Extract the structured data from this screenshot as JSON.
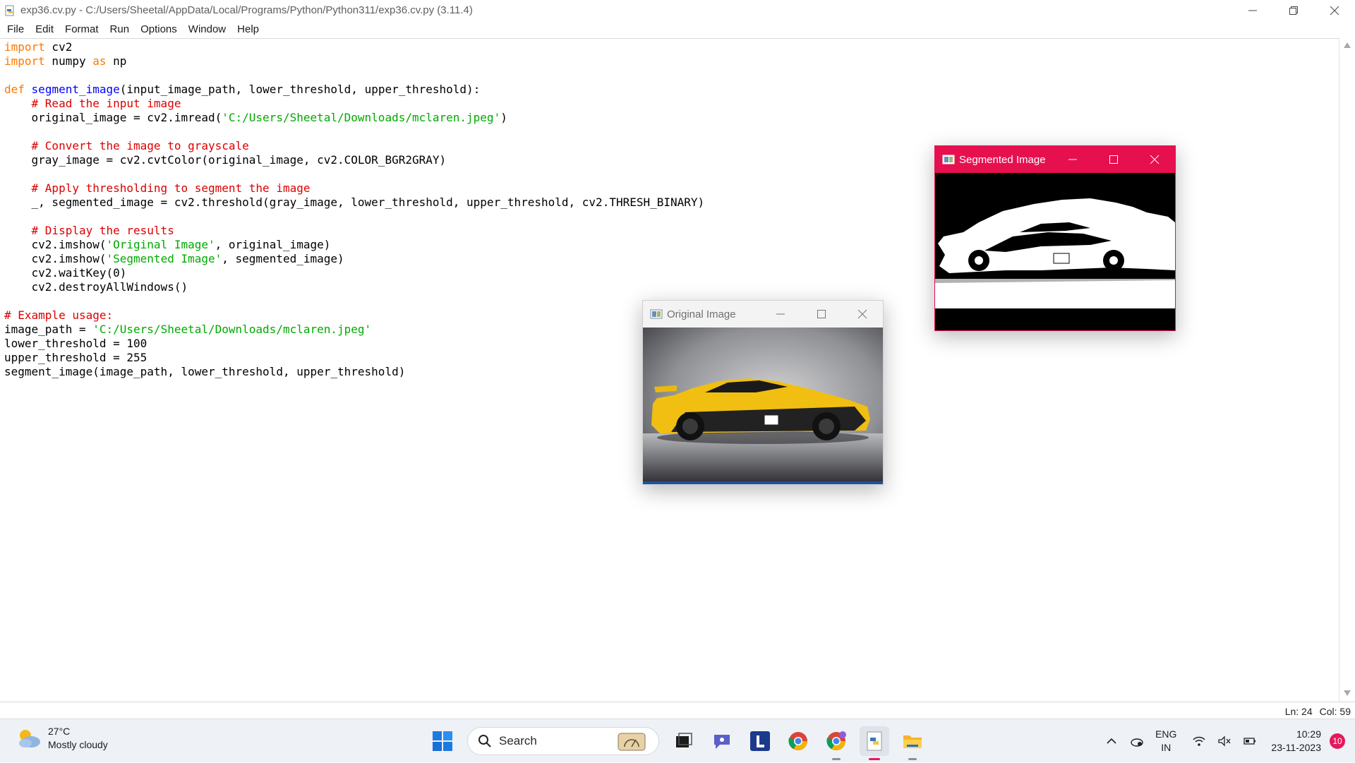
{
  "window": {
    "title": "exp36.cv.py - C:/Users/Sheetal/AppData/Local/Programs/Python/Python311/exp36.cv.py (3.11.4)"
  },
  "menu": [
    "File",
    "Edit",
    "Format",
    "Run",
    "Options",
    "Window",
    "Help"
  ],
  "code_lines": [
    [
      {
        "t": "import",
        "c": "kw"
      },
      {
        "t": " cv2",
        "c": ""
      }
    ],
    [
      {
        "t": "import",
        "c": "kw"
      },
      {
        "t": " numpy ",
        "c": ""
      },
      {
        "t": "as",
        "c": "kw"
      },
      {
        "t": " np",
        "c": ""
      }
    ],
    [],
    [
      {
        "t": "def",
        "c": "kw"
      },
      {
        "t": " ",
        "c": ""
      },
      {
        "t": "segment_image",
        "c": "fn"
      },
      {
        "t": "(input_image_path, lower_threshold, upper_threshold):",
        "c": ""
      }
    ],
    [
      {
        "t": "    ",
        "c": ""
      },
      {
        "t": "# Read the input image",
        "c": "cm"
      }
    ],
    [
      {
        "t": "    original_image = cv2.imread(",
        "c": ""
      },
      {
        "t": "'C:/Users/Sheetal/Downloads/mclaren.jpeg'",
        "c": "str"
      },
      {
        "t": ")",
        "c": ""
      }
    ],
    [],
    [
      {
        "t": "    ",
        "c": ""
      },
      {
        "t": "# Convert the image to grayscale",
        "c": "cm"
      }
    ],
    [
      {
        "t": "    gray_image = cv2.cvtColor(original_image, cv2.COLOR_BGR2GRAY)",
        "c": ""
      }
    ],
    [],
    [
      {
        "t": "    ",
        "c": ""
      },
      {
        "t": "# Apply thresholding to segment the image",
        "c": "cm"
      }
    ],
    [
      {
        "t": "    _, segmented_image = cv2.threshold(gray_image, lower_threshold, upper_threshold, cv2.THRESH_BINARY)",
        "c": ""
      }
    ],
    [],
    [
      {
        "t": "    ",
        "c": ""
      },
      {
        "t": "# Display the results",
        "c": "cm"
      }
    ],
    [
      {
        "t": "    cv2.imshow(",
        "c": ""
      },
      {
        "t": "'Original Image'",
        "c": "str"
      },
      {
        "t": ", original_image)",
        "c": ""
      }
    ],
    [
      {
        "t": "    cv2.imshow(",
        "c": ""
      },
      {
        "t": "'Segmented Image'",
        "c": "str"
      },
      {
        "t": ", segmented_image)",
        "c": ""
      }
    ],
    [
      {
        "t": "    cv2.waitKey(0)",
        "c": ""
      }
    ],
    [
      {
        "t": "    cv2.destroyAllWindows()",
        "c": ""
      }
    ],
    [],
    [
      {
        "t": "# Example usage:",
        "c": "cm"
      }
    ],
    [
      {
        "t": "image_path = ",
        "c": ""
      },
      {
        "t": "'C:/Users/Sheetal/Downloads/mclaren.jpeg'",
        "c": "str"
      }
    ],
    [
      {
        "t": "lower_threshold = 100",
        "c": ""
      }
    ],
    [
      {
        "t": "upper_threshold = 255",
        "c": ""
      }
    ],
    [
      {
        "t": "segment_image(image_path, lower_threshold, upper_threshold)",
        "c": ""
      }
    ]
  ],
  "status": {
    "line": "Ln: 24",
    "col": "Col: 59"
  },
  "original_window": {
    "title": "Original Image"
  },
  "segmented_window": {
    "title": "Segmented Image",
    "accent": "#e6104f"
  },
  "taskbar": {
    "weather_temp": "27°C",
    "weather_desc": "Mostly cloudy",
    "search_label": "Search",
    "lang_1": "ENG",
    "lang_2": "IN",
    "time": "10:29",
    "date": "23-11-2023",
    "notifications": "10"
  },
  "colors": {
    "keyword": "#ff7700",
    "function": "#0000ff",
    "string": "#00aa00",
    "comment": "#dd0000"
  }
}
